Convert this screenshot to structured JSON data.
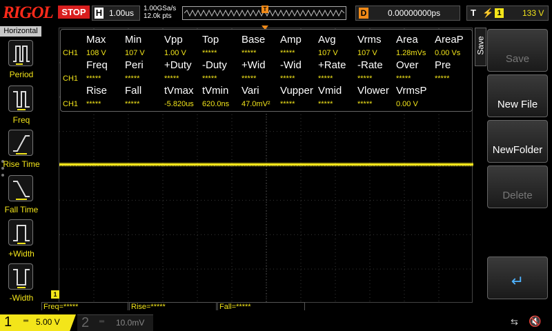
{
  "header": {
    "logo": "RIGOL",
    "run_state": "STOP",
    "horizontal_label": "H",
    "timebase": "1.00us",
    "sample_rate": "1.00GSa/s",
    "memory_depth": "12.0k pts",
    "trigger_marker": "T",
    "delay_label": "D",
    "delay_value": "0.00000000ps",
    "trigger_label": "T",
    "trigger_source": "1",
    "trigger_level": "133 V"
  },
  "left_menu": {
    "title": "Horizontal",
    "items": [
      {
        "label": "Period"
      },
      {
        "label": "Freq"
      },
      {
        "label": "Rise Time"
      },
      {
        "label": "Fall Time"
      },
      {
        "label": "+Width"
      },
      {
        "label": "-Width"
      }
    ]
  },
  "measurements": {
    "rows": [
      {
        "headers": [
          "Max",
          "Min",
          "Vpp",
          "Top",
          "Base",
          "Amp",
          "Avg",
          "Vrms",
          "Area",
          "AreaP"
        ],
        "channel": "CH1",
        "values": [
          "108 V",
          "107 V",
          "1.00 V",
          "*****",
          "*****",
          "*****",
          "107 V",
          "107 V",
          "1.28mVs",
          "0.00 Vs"
        ]
      },
      {
        "headers": [
          "Freq",
          "Peri",
          "+Duty",
          "-Duty",
          "+Wid",
          "-Wid",
          "+Rate",
          "-Rate",
          "Over",
          "Pre"
        ],
        "channel": "CH1",
        "values": [
          "*****",
          "*****",
          "*****",
          "*****",
          "*****",
          "*****",
          "*****",
          "*****",
          "*****",
          "*****"
        ]
      },
      {
        "headers": [
          "Rise",
          "Fall",
          "tVmax",
          "tVmin",
          "Vari",
          "Vupper",
          "Vmid",
          "Vlower",
          "VrmsP",
          ""
        ],
        "channel": "CH1",
        "values": [
          "*****",
          "*****",
          "-5.820us",
          "620.0ns",
          "47.0mV²",
          "*****",
          "*****",
          "*****",
          "0.00 V",
          ""
        ]
      }
    ]
  },
  "right_menu": {
    "tab_label": "Save",
    "buttons": [
      {
        "label": "Save",
        "enabled": false
      },
      {
        "label": "New File",
        "enabled": true
      },
      {
        "label": "NewFolder",
        "enabled": true
      },
      {
        "label": "Delete",
        "enabled": false
      },
      {
        "label": "↵",
        "enabled": true
      }
    ]
  },
  "counters": {
    "freq": "Freq=*****",
    "rise": "Rise=*****",
    "fall": "Fall=*****"
  },
  "channels": {
    "ch1": {
      "number": "1",
      "coupling": "═",
      "scale": "5.00 V"
    },
    "ch2": {
      "number": "2",
      "coupling": "═",
      "scale": "10.0mV"
    }
  },
  "status": {
    "usb_icon": "usb-icon",
    "mute_icon": "speaker-mute-icon"
  },
  "colors": {
    "ch1": "#f3e51a",
    "stop": "#d81e1e",
    "trigger": "#f08a18",
    "logo": "#ff2a1a"
  },
  "trace": {
    "channel": "CH1",
    "level_volts": 107
  }
}
